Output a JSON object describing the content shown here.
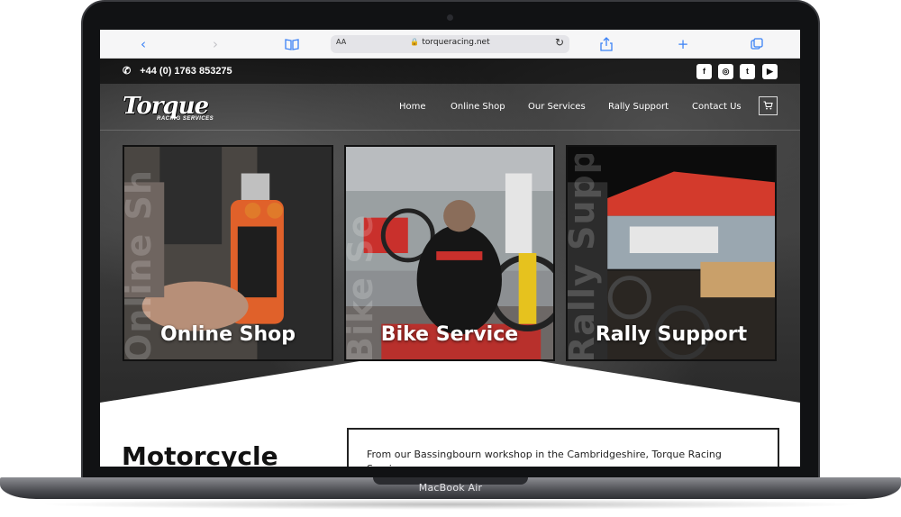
{
  "browser": {
    "text_size_label": "AA",
    "url": "torqueracing.net",
    "icons": [
      "chevron-left-icon",
      "chevron-right-icon",
      "book-icon",
      "lock-icon",
      "reload-icon",
      "share-icon",
      "plus-icon",
      "tabs-icon"
    ]
  },
  "topbar": {
    "phone": "+44 (0) 1763 853275",
    "social": [
      {
        "name": "facebook-icon",
        "glyph": "f"
      },
      {
        "name": "instagram-icon",
        "glyph": "◎"
      },
      {
        "name": "twitter-icon",
        "glyph": "t"
      },
      {
        "name": "youtube-icon",
        "glyph": "▶"
      }
    ]
  },
  "logo": {
    "word": "Torque",
    "sub": "RACING SERVICES"
  },
  "nav": {
    "items": [
      "Home",
      "Online Shop",
      "Our Services",
      "Rally Support",
      "Contact Us"
    ]
  },
  "cards": [
    {
      "title": "Online Shop",
      "vertical": "Online Sh"
    },
    {
      "title": "Bike Service",
      "vertical": "Bike Se"
    },
    {
      "title": "Rally Support",
      "vertical": "Rally Supp"
    }
  ],
  "content": {
    "heading": "Motorcycle",
    "intro": "From our Bassingbourn workshop in the Cambridgeshire, Torque Racing Services"
  },
  "device": {
    "label": "MacBook Air"
  },
  "colors": {
    "browser_accent": "#3b82f6",
    "hero_dark": "#2b2b2b",
    "card_shop_orange": "#e0612a",
    "card_service_red": "#c9302c",
    "card_rally_tent": "#d33a2c"
  }
}
